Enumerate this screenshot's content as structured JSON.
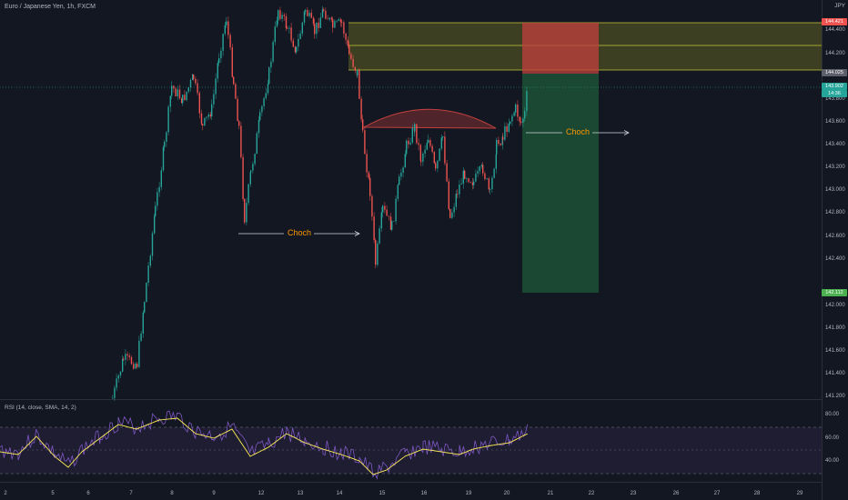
{
  "symbol_title": "Euro / Japanese Yen, 1h, FXCM",
  "currency": "JPY",
  "rsi_title": "RSI (14, close, SMA, 14, 2)",
  "price_axis": [
    "144.400",
    "144.200",
    "143.800",
    "143.600",
    "143.400",
    "143.200",
    "143.000",
    "142.800",
    "142.600",
    "142.400",
    "142.000",
    "141.800",
    "141.600",
    "141.400",
    "141.200"
  ],
  "rsi_axis": [
    "80.00",
    "60.00",
    "40.00"
  ],
  "time_axis": [
    "2",
    "5",
    "6",
    "7",
    "8",
    "9",
    "12",
    "13",
    "14",
    "15",
    "16",
    "19",
    "20",
    "21",
    "22",
    "23",
    "26",
    "27",
    "28",
    "29"
  ],
  "tags": {
    "stop": "144.421",
    "entry": "144.025",
    "price": "143.902",
    "countdown": "14:36",
    "target": "142.112"
  },
  "annotations": {
    "choch_1": "Choch",
    "choch_2": "Choch"
  },
  "colors": {
    "background": "#131722",
    "bull": "#26a69a",
    "bear": "#ef5350",
    "zone": "#9b9b28",
    "stop_fill": "#c0403d",
    "target_fill": "#1f4d35",
    "rsi": "#7e57c2",
    "rsi_ma": "#ffee58"
  }
}
